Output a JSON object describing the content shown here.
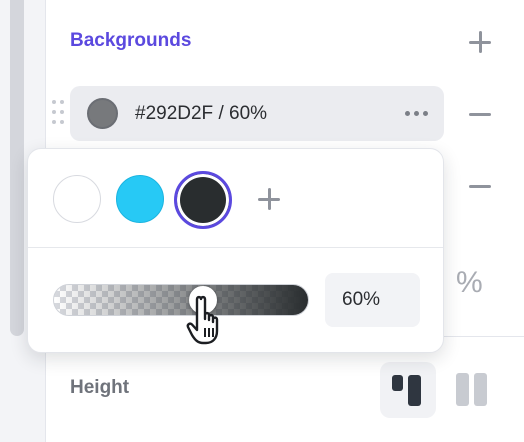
{
  "panel": {
    "section_title": "Backgrounds",
    "height_label": "Height",
    "percent_symbol": "%"
  },
  "background_item": {
    "value": "#292D2F / 60%",
    "color_hex": "#292D2F",
    "opacity_percent": 60
  },
  "color_picker": {
    "swatches": [
      {
        "name": "white",
        "color": "#FFFFFF",
        "selected": false
      },
      {
        "name": "cyan",
        "color": "#27C9F5",
        "selected": false
      },
      {
        "name": "dark",
        "color": "#292D2F",
        "selected": true
      }
    ],
    "opacity_value": "60%",
    "opacity_fraction": 0.6
  },
  "icons": {
    "add": "plus-icon",
    "remove": "minus-icon",
    "more": "more-horizontal-icon",
    "drag": "drag-handle-icon",
    "cursor": "hand-pointer-icon",
    "align_active": "align-top-icon",
    "align_inactive": "align-stretch-icon"
  },
  "colors": {
    "accent": "#5B49DF",
    "text": "#2B2D31",
    "muted": "#8F939C"
  }
}
